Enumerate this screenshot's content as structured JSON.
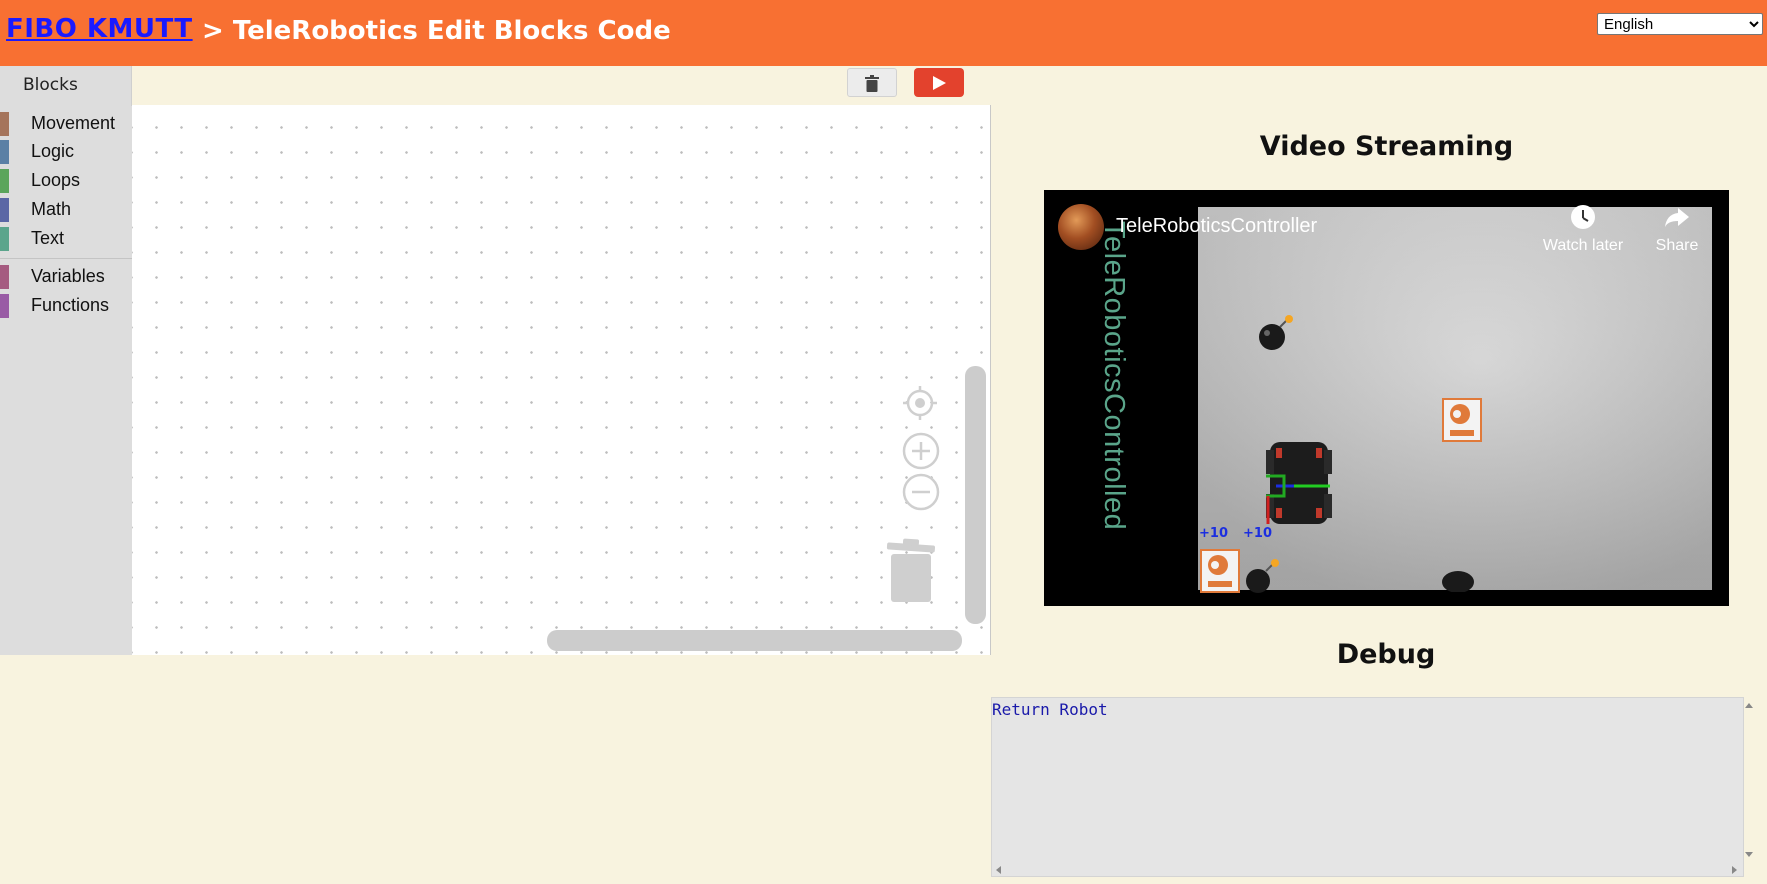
{
  "header": {
    "brand_link": "FIBO KMUTT",
    "title": "> TeleRobotics Edit Blocks Code",
    "language": {
      "selected": "English",
      "options": [
        "English"
      ]
    }
  },
  "blockly": {
    "toolbox_header": "Blocks",
    "categories": [
      {
        "label": "Movement",
        "color": "#a5745b"
      },
      {
        "label": "Logic",
        "color": "#5b80a5"
      },
      {
        "label": "Loops",
        "color": "#5ba55b"
      },
      {
        "label": "Math",
        "color": "#5b67a5"
      },
      {
        "label": "Text",
        "color": "#5ba58c"
      },
      {
        "label": "Variables",
        "color": "#a55b80"
      },
      {
        "label": "Functions",
        "color": "#995ba5"
      }
    ],
    "trash_button_icon": "trash-icon",
    "run_button_icon": "play-icon",
    "run_button_color": "#e3422d"
  },
  "video": {
    "section_title": "Video Streaming",
    "channel_name": "TeleRoboticsController",
    "overlay_vertical_text": "TeleRoboticsControlled",
    "watch_later_label": "Watch later",
    "share_label": "Share",
    "coord_x": "+10",
    "coord_y": "+10"
  },
  "debug": {
    "section_title": "Debug",
    "output": "Return Robot"
  },
  "colors": {
    "header_bg": "#f87032",
    "page_bg": "#f8f3df",
    "link": "#1a1aff"
  }
}
